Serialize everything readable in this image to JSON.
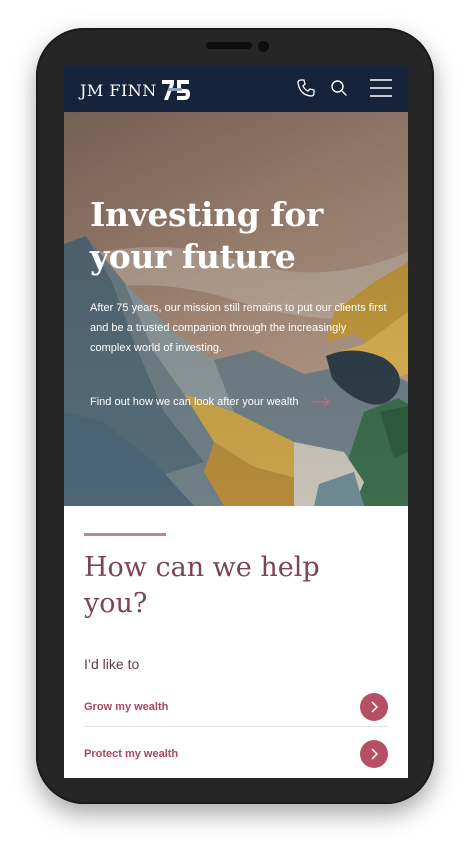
{
  "header": {
    "logo_text": "JM FINN",
    "logo_badge": "75",
    "icons": [
      "phone-icon",
      "search-icon",
      "menu-icon"
    ]
  },
  "hero": {
    "title": "Investing for your future",
    "body": "After 75 years, our mission still remains to put our clients first and be a trusted companion through the increasingly complex world of investing.",
    "link_label": "Find out how we can look after your wealth"
  },
  "help": {
    "title": "How can we help you?",
    "subtitle": "I’d like to",
    "options": [
      {
        "label": "Grow my wealth"
      },
      {
        "label": "Protect my wealth"
      }
    ]
  },
  "colors": {
    "navy": "#15243a",
    "plum": "#7d4358",
    "rose": "#b64e64",
    "accent_rule": "#b78b93"
  }
}
